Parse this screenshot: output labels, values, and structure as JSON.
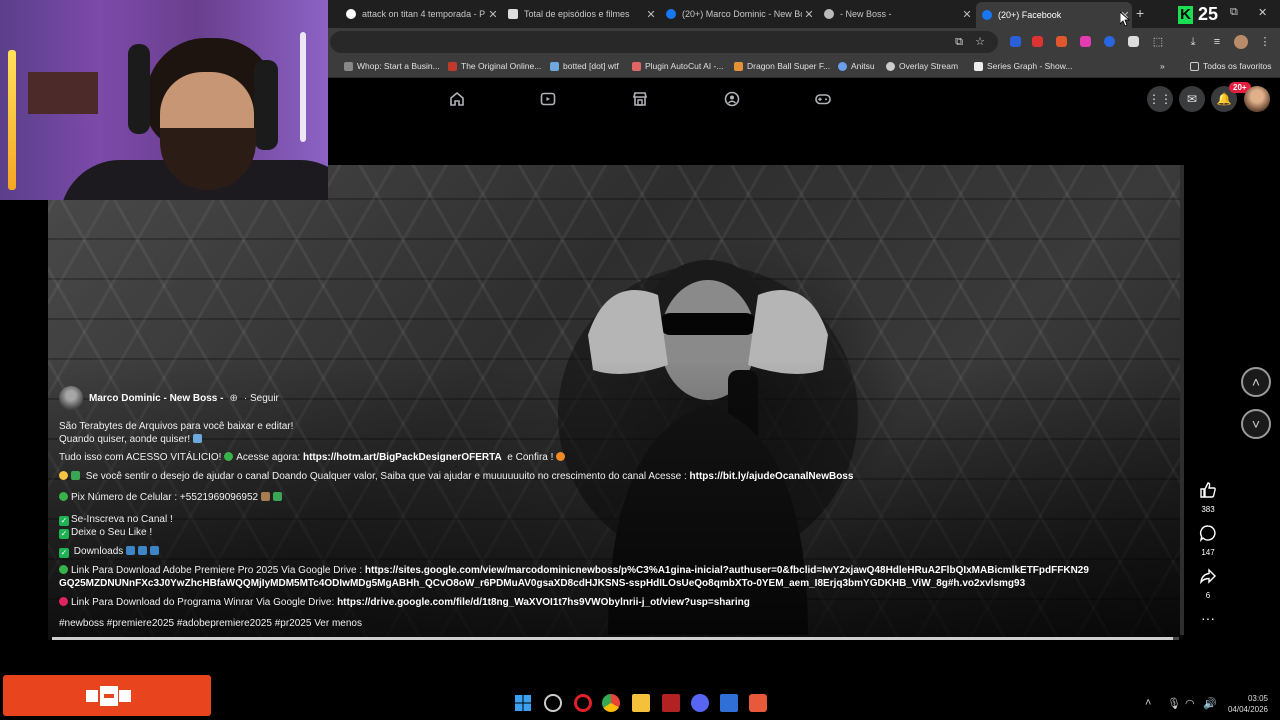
{
  "browser": {
    "tabs": [
      {
        "title": "attack on titan 4 temporada - P",
        "icon": "google-icon",
        "color": "#ffffff"
      },
      {
        "title": "Total de episódios e filmes",
        "icon": "document-icon",
        "color": "#ffffff"
      },
      {
        "title": "(20+) Marco Dominic - New Bo",
        "icon": "facebook-icon",
        "color": "#1877f2"
      },
      {
        "title": "- New Boss -",
        "icon": "globe-icon",
        "color": "#bbbbbb"
      },
      {
        "title": "(20+) Facebook",
        "icon": "facebook-icon",
        "color": "#1877f2"
      }
    ],
    "k_badge": "25",
    "bookmarks": [
      {
        "label": "Whop: Start a Busin...",
        "color": "#888888"
      },
      {
        "label": "The Original Online...",
        "color": "#c0392b"
      },
      {
        "label": "botted [dot] wtf",
        "color": "#6fa8dc"
      },
      {
        "label": "Plugin AutoCut AI -...",
        "color": "#e06666"
      },
      {
        "label": "Dragon Ball Super F...",
        "color": "#e69138"
      },
      {
        "label": "Anitsu",
        "color": "#6d9eeb"
      },
      {
        "label": "Overlay Stream",
        "color": "#cccccc"
      },
      {
        "label": "Series Graph - Show...",
        "color": "#eeeeee"
      },
      {
        "label": "Todos os favoritos",
        "color": "#cccccc"
      }
    ]
  },
  "facebook": {
    "notifications_badge": "20+"
  },
  "post": {
    "author": "Marco Dominic - New Boss -",
    "follow_label": "Seguir",
    "line1": "São Terabytes de Arquivos para você baixar e editar!",
    "line2": "Quando quiser, aonde quiser!",
    "access_text": "Tudo isso com ACESSO VITÁLICIO!",
    "access_cta": "Acesse agora:",
    "access_link": "https://hotm.art/BigPackDesignerOFERTA",
    "access_after": "e Confira !",
    "support_text": "Se você sentir o desejo de ajudar o canal Doando Qualquer valor, Saiba que vai ajudar e muuuuuuito no crescimento do canal  Acesse :",
    "support_link": "https://bit.ly/ajudeOcanalNewBoss",
    "pix_text": "Pix Número de Celular : +5521969096952",
    "subscribe": "Se-Inscreva no Canal !",
    "like": "Deixe o Seu Like !",
    "downloads": "Downloads",
    "premiere_label": "Link Para Download Adobe Premiere Pro 2025 Via Google Drive :",
    "premiere_link": "https://sites.google.com/view/marcodominicnewboss/p%C3%A1gina-inicial?authuser=0&fbclid=IwY2xjawQ48HdleHRuA2FlbQIxMABicmlkETFpdFFKN29GQ25MZDNUNnFXc3J0YwZhcHBfaWQQMjIyMDM5MTc4ODIwMDg5MgABHh_QCvO8oW_r6PDMuAV0gsaXD8cdHJKSNS-sspHdILOsUeQo8qmbXTo-0YEM_aem_I8Erjq3bmYGDKHB_ViW_8g#h.vo2xvlsmg93",
    "winrar_label": "Link Para Download do Programa Winrar Via Google Drive:",
    "winrar_link": "https://drive.google.com/file/d/1t8ng_WaXVOI1t7hs9VWObylnrii-j_ot/view?usp=sharing",
    "hashtags": "#newboss #premiere2025 #adobepremiere2025 #pr2025",
    "see_less": "Ver menos"
  },
  "actions": {
    "likes": "383",
    "comments": "147",
    "shares": "6"
  },
  "video": {
    "progress": 0.995
  },
  "taskbar": {
    "time": "03:05",
    "date": "04/04/2026"
  }
}
